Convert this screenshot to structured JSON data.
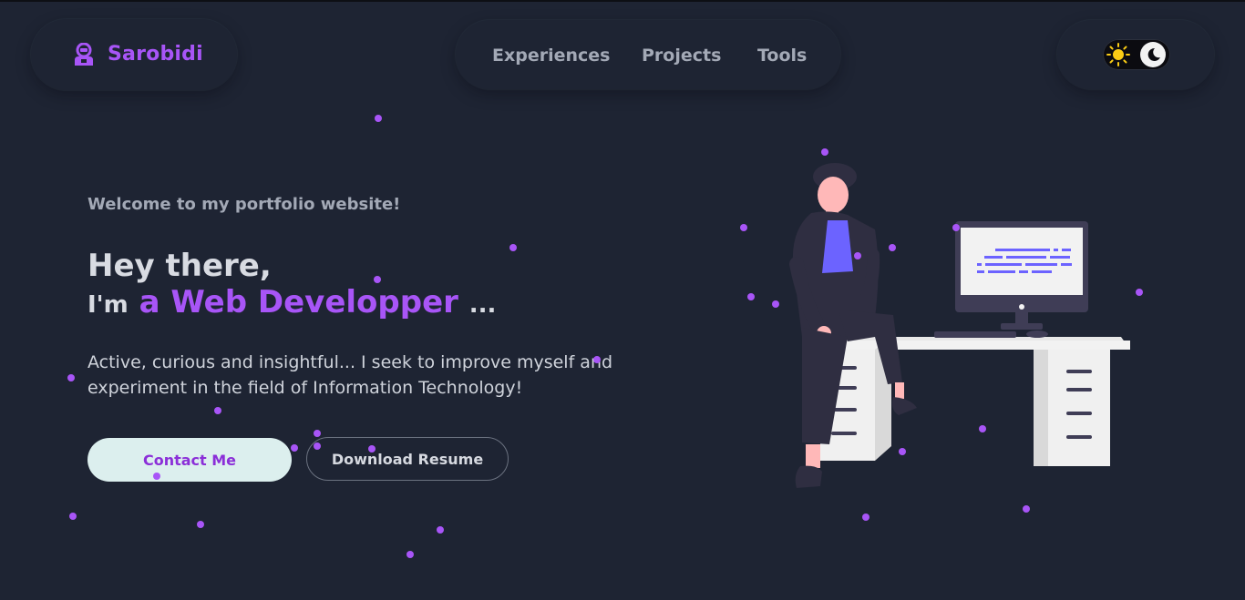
{
  "brand": {
    "name": "Sarobidi",
    "logo_icon": "robot-icon"
  },
  "nav": {
    "items": [
      {
        "label": "Experiences"
      },
      {
        "label": "Projects"
      },
      {
        "label": "Tools"
      }
    ]
  },
  "theme_toggle": {
    "light_icon": "sun-icon",
    "dark_icon": "moon-icon",
    "state": "dark"
  },
  "hero": {
    "welcome": "Welcome to my portfolio website!",
    "greeting": "Hey there,",
    "im": "I'm",
    "role": "a Web Developper",
    "ellipsis": "...",
    "description": "Active, curious and insightful... I seek to improve myself and experiment in the field of Information Technology!",
    "contact_label": "Contact Me",
    "resume_label": "Download Resume"
  },
  "colors": {
    "background": "#1e2433",
    "accent": "#a855f7",
    "contact_bg": "#dcefee",
    "nav_text": "#a3a9b6"
  }
}
